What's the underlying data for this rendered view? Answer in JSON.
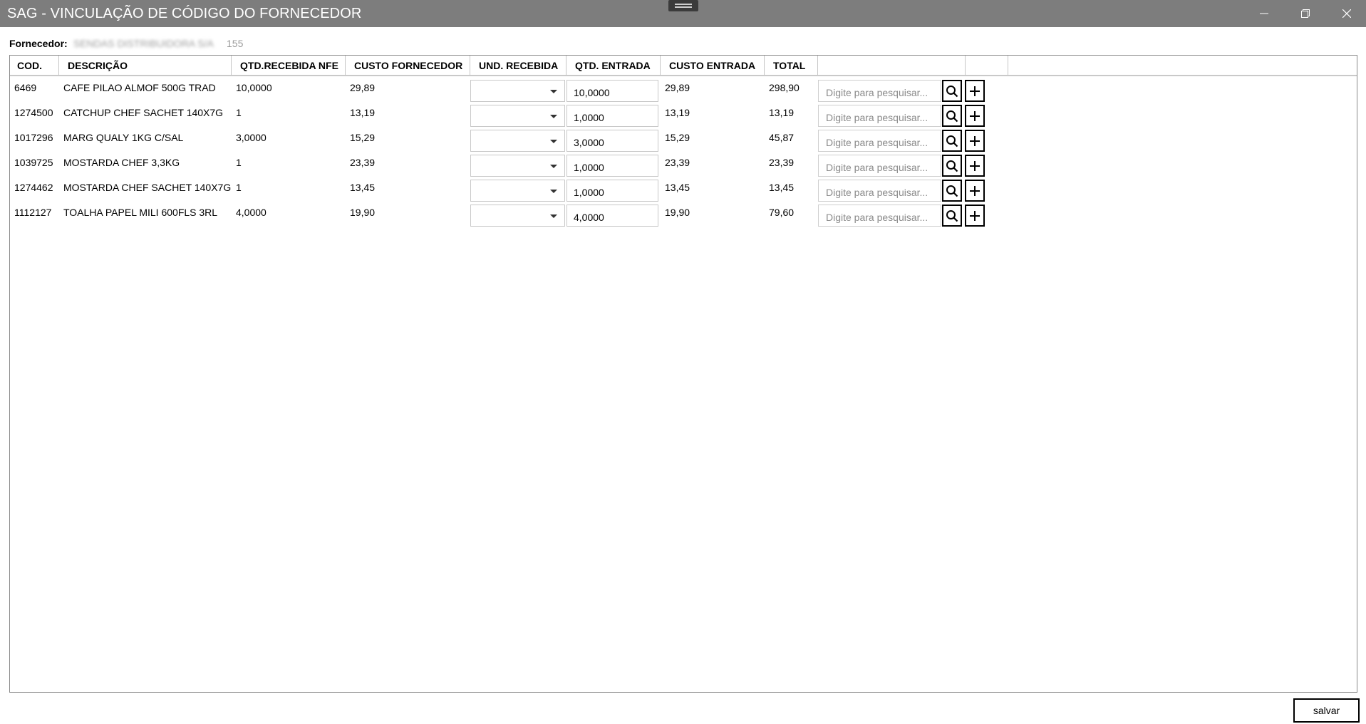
{
  "window": {
    "title": "SAG - VINCULAÇÃO DE CÓDIGO DO FORNECEDOR"
  },
  "fornecedor": {
    "label": "Fornecedor:",
    "value_obscured": "SENDAS DISTRIBUIDORA S/A",
    "value_suffix": "155"
  },
  "table": {
    "columns": [
      "COD.",
      "DESCRIÇÃO",
      "QTD.RECEBIDA NFE",
      "CUSTO FORNECEDOR",
      "UND. RECEBIDA",
      "QTD. ENTRADA",
      "CUSTO ENTRADA",
      "TOTAL",
      "",
      ""
    ],
    "search_placeholder": "Digite para pesquisar...",
    "rows": [
      {
        "cod": "6469",
        "descricao": "CAFE PILAO ALMOF 500G TRAD",
        "qtd_recebida_nfe": "10,0000",
        "custo_fornecedor": "29,89",
        "und_recebida": "",
        "qtd_entrada": "10,0000",
        "custo_entrada": "29,89",
        "total": "298,90"
      },
      {
        "cod": "1274500",
        "descricao": "CATCHUP CHEF SACHET 140X7G",
        "qtd_recebida_nfe": "1",
        "custo_fornecedor": "13,19",
        "und_recebida": "",
        "qtd_entrada": "1,0000",
        "custo_entrada": "13,19",
        "total": "13,19"
      },
      {
        "cod": "1017296",
        "descricao": "MARG QUALY 1KG C/SAL",
        "qtd_recebida_nfe": "3,0000",
        "custo_fornecedor": "15,29",
        "und_recebida": "",
        "qtd_entrada": "3,0000",
        "custo_entrada": "15,29",
        "total": "45,87"
      },
      {
        "cod": "1039725",
        "descricao": "MOSTARDA CHEF 3,3KG",
        "qtd_recebida_nfe": "1",
        "custo_fornecedor": "23,39",
        "und_recebida": "",
        "qtd_entrada": "1,0000",
        "custo_entrada": "23,39",
        "total": "23,39"
      },
      {
        "cod": "1274462",
        "descricao": "MOSTARDA CHEF SACHET 140X7G",
        "qtd_recebida_nfe": "1",
        "custo_fornecedor": "13,45",
        "und_recebida": "",
        "qtd_entrada": "1,0000",
        "custo_entrada": "13,45",
        "total": "13,45"
      },
      {
        "cod": "1112127",
        "descricao": "TOALHA PAPEL MILI 600FLS 3RL",
        "qtd_recebida_nfe": "4,0000",
        "custo_fornecedor": "19,90",
        "und_recebida": "",
        "qtd_entrada": "4,0000",
        "custo_entrada": "19,90",
        "total": "79,60"
      }
    ]
  },
  "footer": {
    "save_label": "salvar"
  }
}
